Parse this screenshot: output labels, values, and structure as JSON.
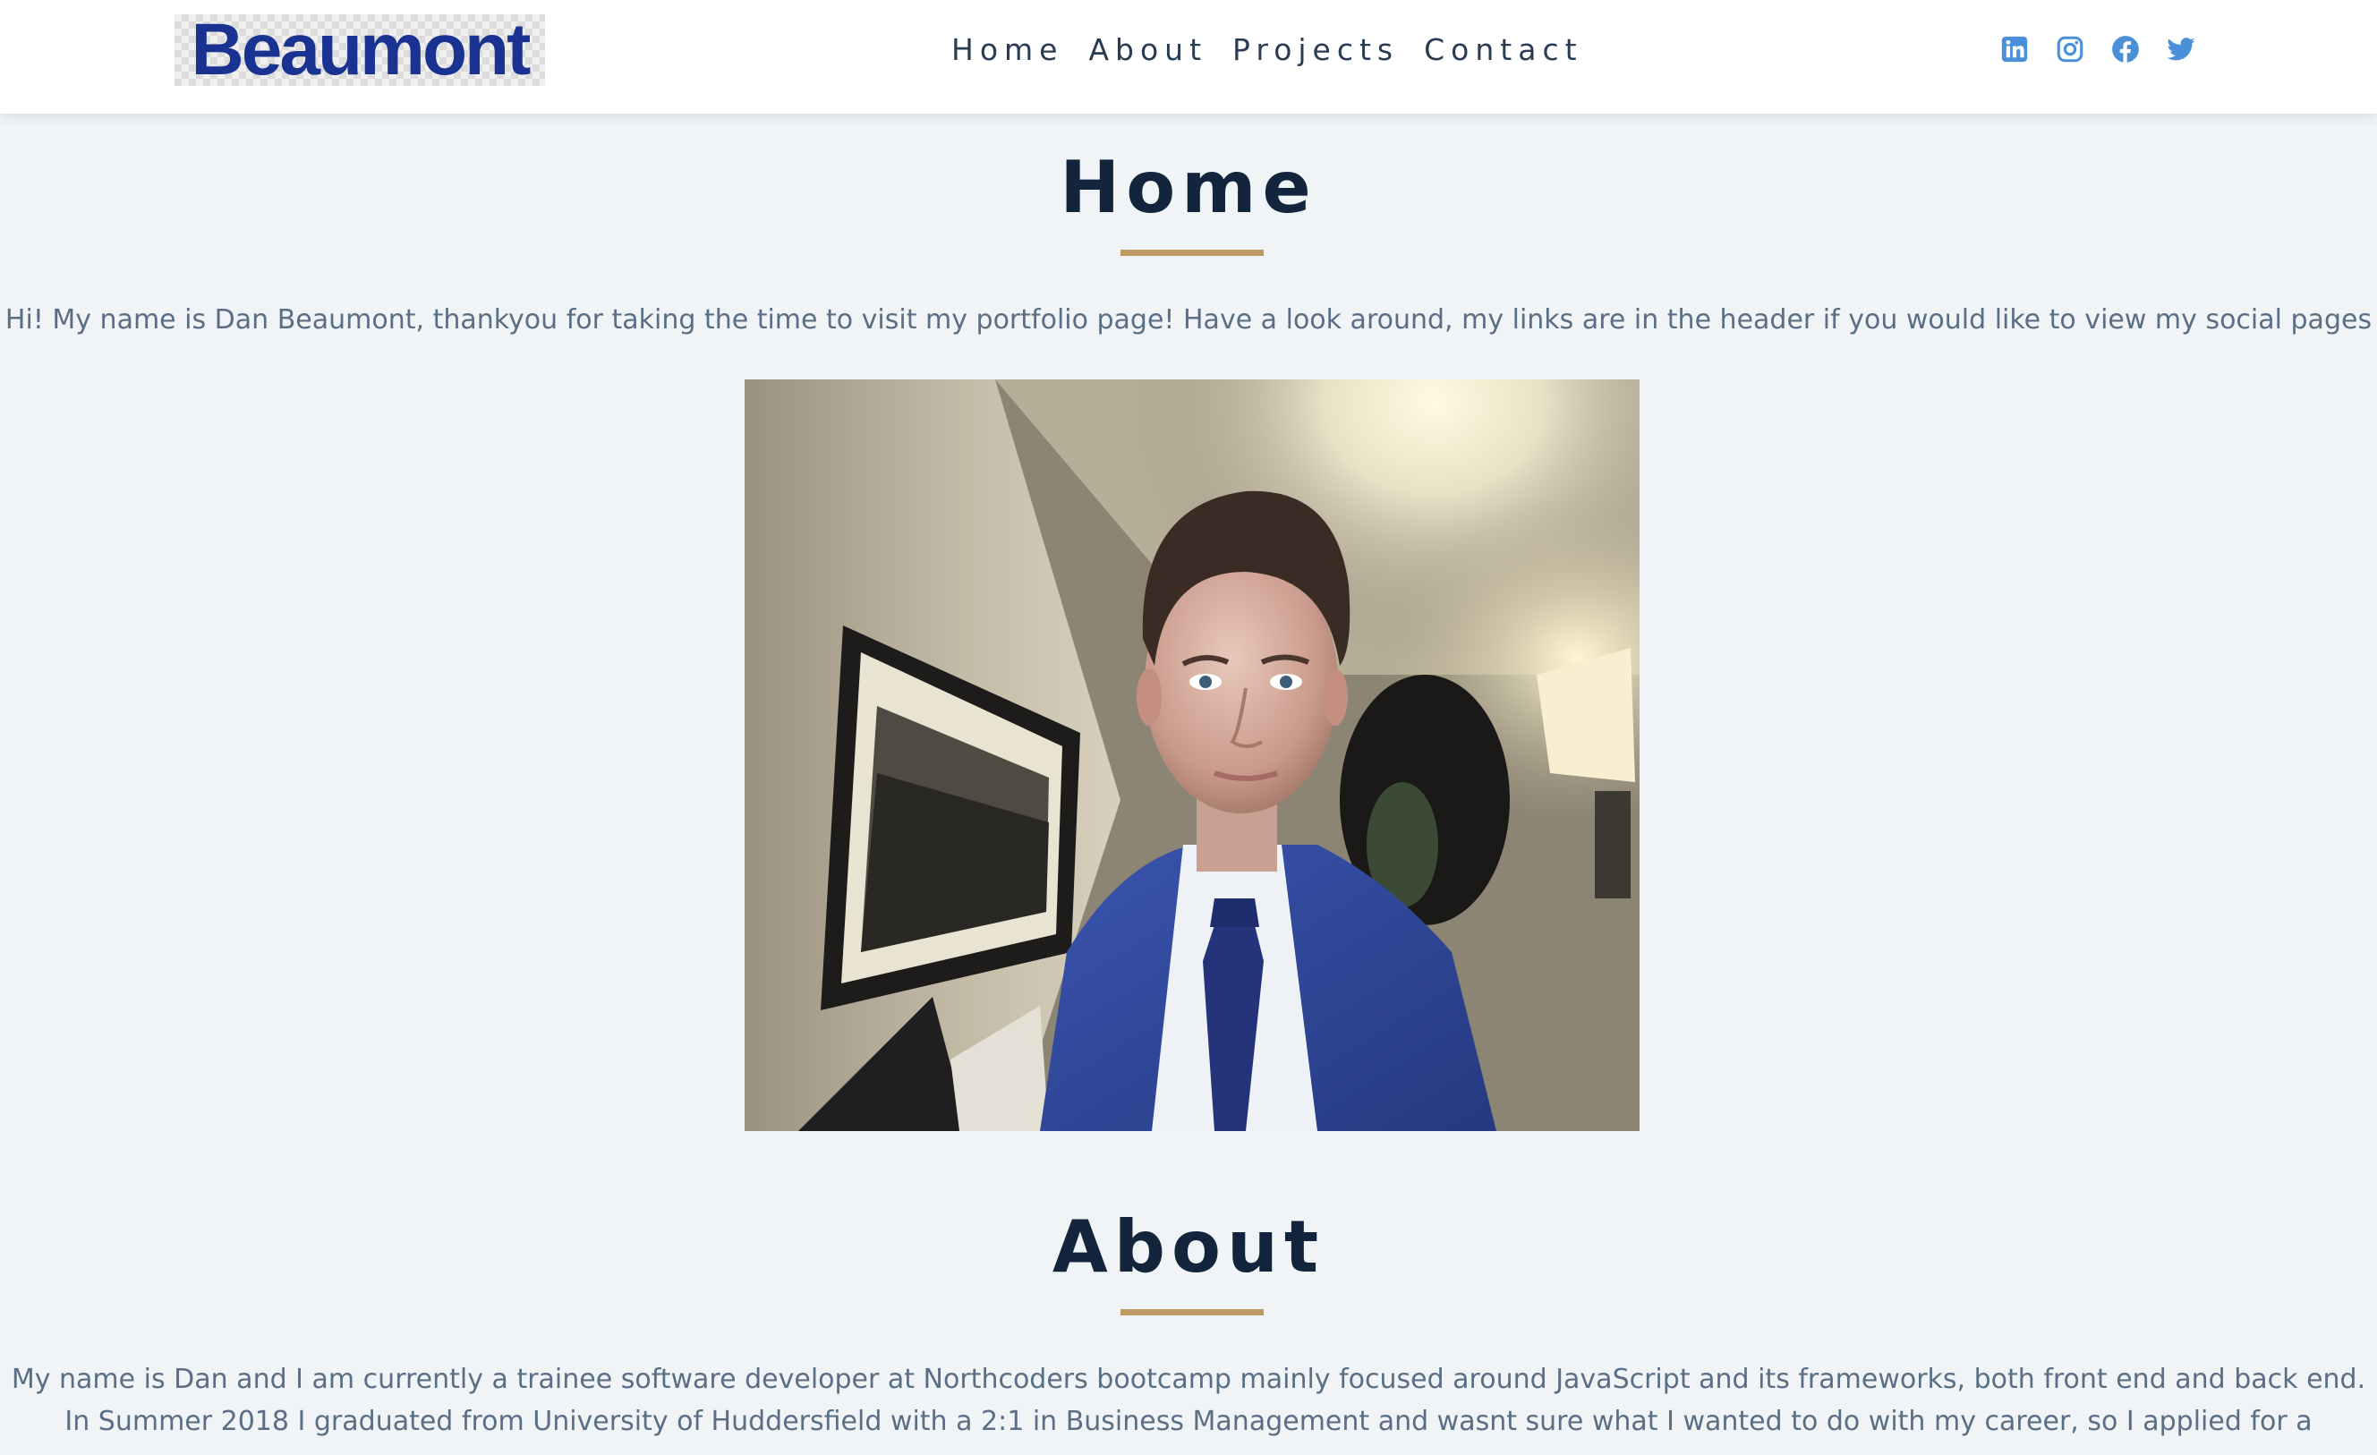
{
  "header": {
    "logo_text": "Beaumont",
    "nav": [
      "Home",
      "About",
      "Projects",
      "Contact"
    ],
    "social_icons": [
      "linkedin-icon",
      "instagram-icon",
      "facebook-icon",
      "twitter-icon"
    ],
    "icon_color": "#4a90d9"
  },
  "home": {
    "title": "Home",
    "intro": "Hi! My name is Dan Beaumont, thankyou for taking the time to visit my portfolio page! Have a look around, my links are in the header if you would like to view my social pages"
  },
  "about": {
    "title": "About",
    "line1": "My name is Dan and I am currently a trainee software developer at Northcoders bootcamp mainly focused around JavaScript and its frameworks, both front end and back end.",
    "line2": "In Summer 2018 I graduated from University of Huddersfield with a 2:1 in Business Management and wasnt sure what I wanted to do with my career, so I applied for a"
  },
  "colors": {
    "title": "#13253d",
    "accent": "#c09a66",
    "body_text": "#5a6f85",
    "logo": "#1a3292",
    "background": "#f0f4f7"
  }
}
